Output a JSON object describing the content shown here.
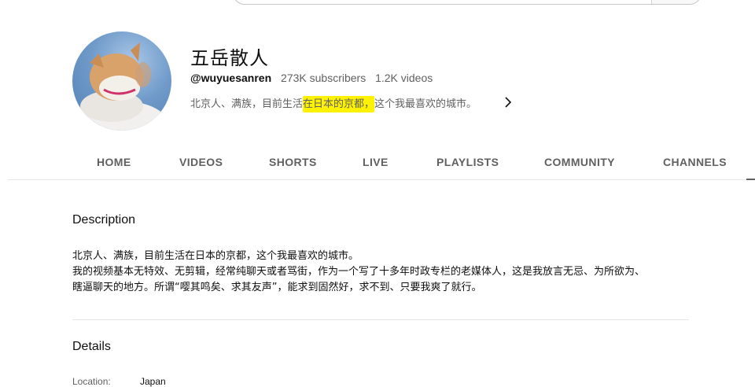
{
  "channel": {
    "name": "五岳散人",
    "handle": "@wuyuesanren",
    "subscribers": "273K subscribers",
    "videos": "1.2K videos",
    "tagline_before": "北京人、满族，目前生活",
    "tagline_highlight": "在日本的京都，",
    "tagline_after": "这个我最喜欢的城市。"
  },
  "tabs": [
    "HOME",
    "VIDEOS",
    "SHORTS",
    "LIVE",
    "PLAYLISTS",
    "COMMUNITY",
    "CHANNELS"
  ],
  "description": {
    "title": "Description",
    "lines": [
      "北京人、满族，目前生活在日本的京都，这个我最喜欢的城市。",
      "我的视频基本无特效、无剪辑，经常纯聊天或者骂街，作为一个写了十多年时政专栏的老媒体人，这是我放言无忌、为所欲为、",
      "瞎逼聊天的地方。所谓“嘤其鸣矣、求其友声”，能求到固然好，求不到、只要我爽了就行。"
    ]
  },
  "details": {
    "title": "Details",
    "location_label": "Location:",
    "location_value": "Japan"
  },
  "colors": {
    "highlight": "#fff200",
    "text_primary": "#0f0f0f",
    "text_secondary": "#606060"
  },
  "icons": {
    "expand": "chevron-right-icon"
  }
}
